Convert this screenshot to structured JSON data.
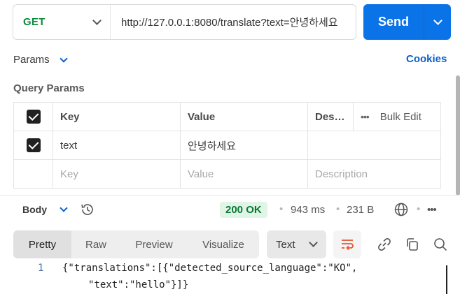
{
  "request": {
    "method": "GET",
    "url": "http://127.0.0.1:8080/translate?text=안녕하세요",
    "send_label": "Send"
  },
  "params_tab": {
    "label": "Params"
  },
  "cookies_label": "Cookies",
  "query_params": {
    "title": "Query Params",
    "headers": {
      "key": "Key",
      "value": "Value",
      "description": "Des…",
      "bulk_edit": "Bulk Edit"
    },
    "rows": [
      {
        "checked": true,
        "key": "text",
        "value": "안녕하세요",
        "description": ""
      }
    ],
    "placeholders": {
      "key": "Key",
      "value": "Value",
      "description": "Description"
    }
  },
  "response": {
    "body_tab": "Body",
    "status": "200 OK",
    "time": "943 ms",
    "size": "231 B",
    "views": [
      "Pretty",
      "Raw",
      "Preview",
      "Visualize"
    ],
    "active_view": "Pretty",
    "format": "Text",
    "code": {
      "line_number": "1",
      "line1": "{\"translations\":[{\"detected_source_language\":\"KO\",",
      "line2": "\"text\":\"hello\"}]}"
    }
  },
  "colors": {
    "send": "#0b73e8",
    "method_get": "#0a8a3c",
    "link_blue": "#0b60c9",
    "status_ok_bg": "#e0f5e6",
    "status_ok_text": "#0a7a35",
    "wrap_icon": "#e8542f"
  }
}
